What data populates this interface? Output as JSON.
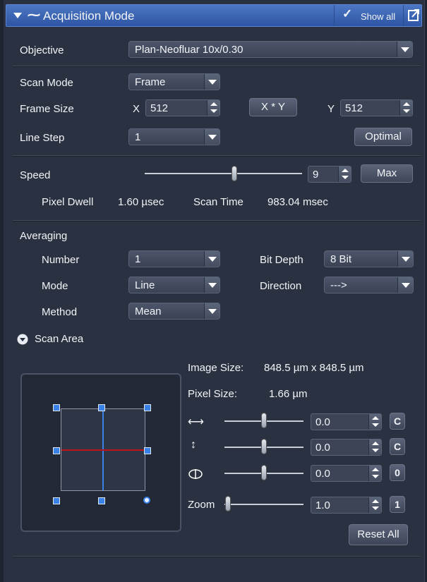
{
  "header": {
    "title": "Acquisition Mode",
    "show_all": "Show all"
  },
  "objective": {
    "label": "Objective",
    "value": "Plan-Neofluar 10x/0.30"
  },
  "scan": {
    "scan_mode_label": "Scan Mode",
    "scan_mode_value": "Frame",
    "frame_size_label": "Frame Size",
    "x_label": "X",
    "x_value": "512",
    "xy_button": "X * Y",
    "y_label": "Y",
    "y_value": "512",
    "line_step_label": "Line Step",
    "line_step_value": "1",
    "optimal_button": "Optimal"
  },
  "speed": {
    "label": "Speed",
    "value": "9",
    "max_button": "Max",
    "slider_fraction": 0.57,
    "pixel_dwell_label": "Pixel Dwell",
    "pixel_dwell_value": "1.60 µsec",
    "scan_time_label": "Scan Time",
    "scan_time_value": "983.04 msec"
  },
  "averaging": {
    "label": "Averaging",
    "number_label": "Number",
    "number_value": "1",
    "mode_label": "Mode",
    "mode_value": "Line",
    "method_label": "Method",
    "method_value": "Mean",
    "bit_depth_label": "Bit Depth",
    "bit_depth_value": "8 Bit",
    "direction_label": "Direction",
    "direction_value": "--->"
  },
  "scan_area": {
    "label": "Scan Area",
    "image_size_label": "Image Size:",
    "image_size_value": "848.5  µm x  848.5  µm",
    "pixel_size_label": "Pixel Size:",
    "pixel_size_value": "1.66 µm",
    "offset_x_value": "0.0",
    "offset_x_reset": "C",
    "offset_y_value": "0.0",
    "offset_y_reset": "C",
    "rotation_value": "0.0",
    "rotation_reset": "0",
    "zoom_label": "Zoom",
    "zoom_value": "1.0",
    "zoom_reset": "1",
    "reset_all": "Reset All"
  },
  "colors": {
    "header": "#3d67b8",
    "panel": "#2a3140",
    "accent_blue": "#3b82e8",
    "line_red": "#c0121b"
  }
}
